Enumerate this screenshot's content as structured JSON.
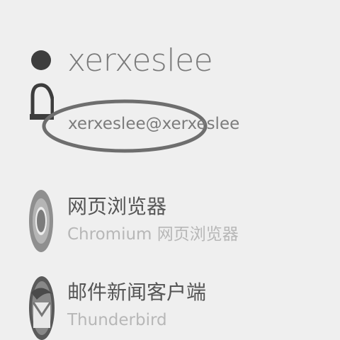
{
  "user": {
    "name": "xerxeslee",
    "email": "xerxeslee@xerxeslee"
  },
  "apps": [
    {
      "title": "网页浏览器",
      "subtitle": "Chromium 网页浏览器",
      "icon": "chromium-icon"
    },
    {
      "title": "邮件新闻客户端",
      "subtitle": "Thunderbird",
      "icon": "thunderbird-icon"
    }
  ],
  "colors": {
    "background": "#efefef",
    "primary_text": "#555555",
    "secondary_text": "#b7b7b7",
    "highlight_ellipse": "#6e6e6e"
  }
}
